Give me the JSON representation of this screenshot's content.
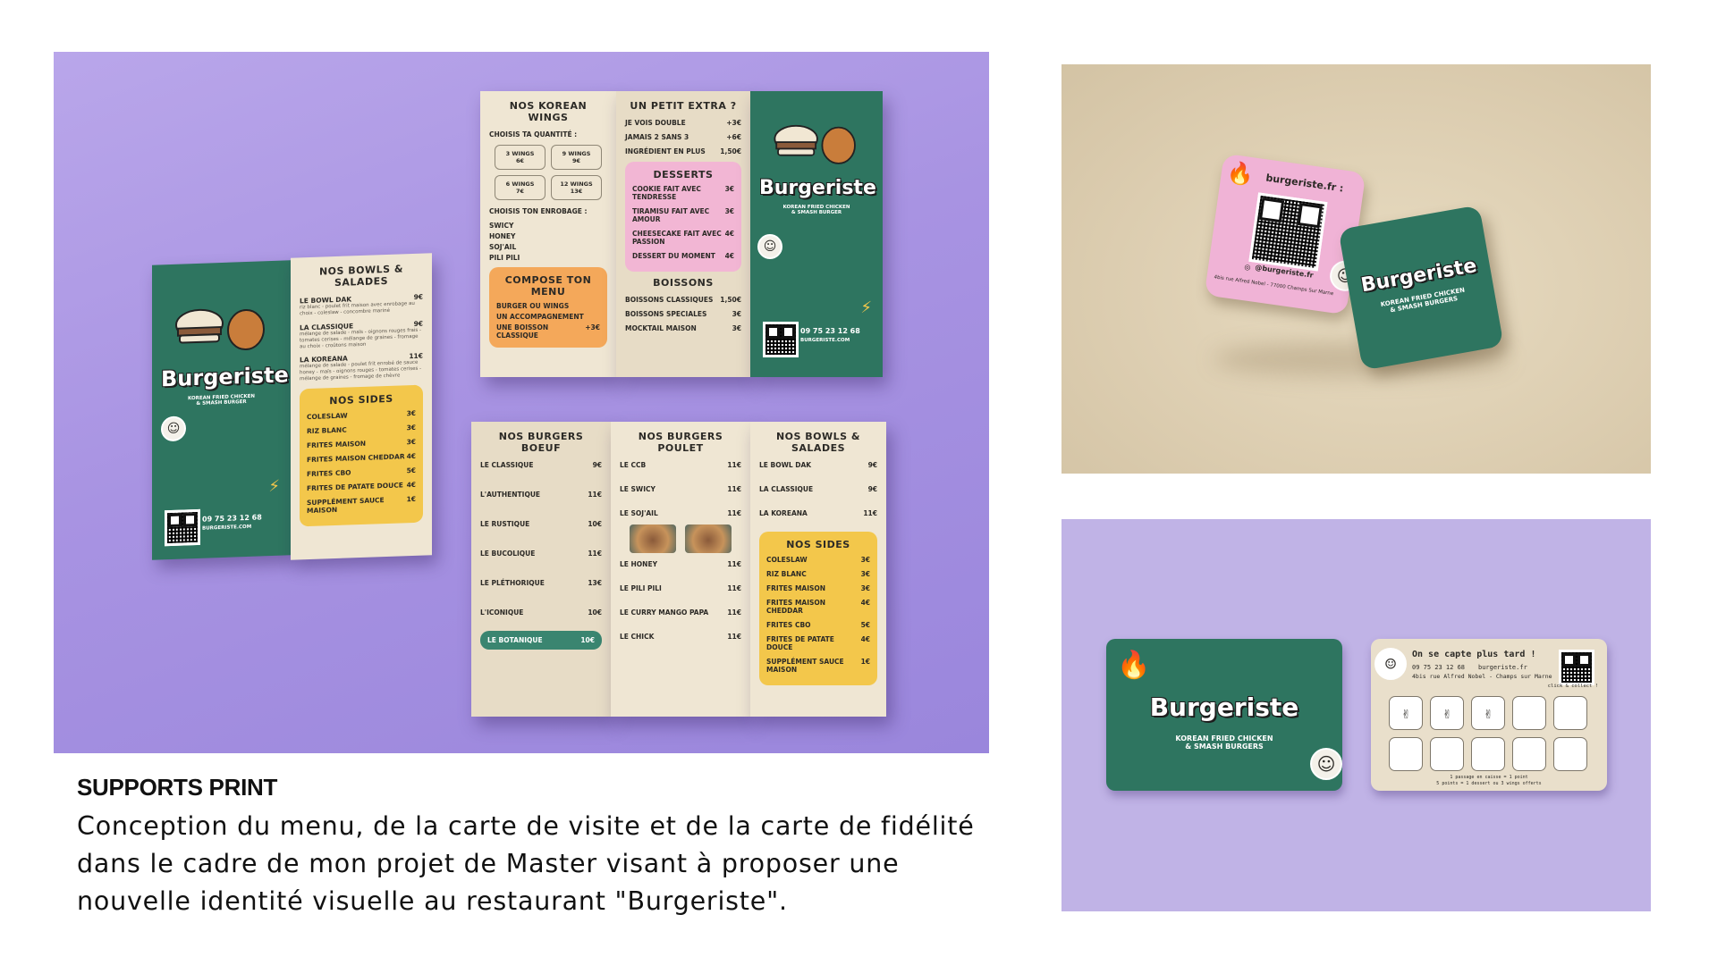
{
  "caption": {
    "title": "SUPPORTS PRINT",
    "text": "Conception du menu, de la carte de visite et de la carte de fidélité dans le cadre de mon projet de Master visant à proposer une nouvelle identité visuelle au restaurant \"Burgeriste\"."
  },
  "brand": {
    "name": "Burgeriste",
    "tagline_1": "KOREAN FRIED CHICKEN",
    "tagline_2": "& SMASH BURGER",
    "tagline_2_plural": "& SMASH BURGERS",
    "phone": "09 75 23 12 68",
    "website": "BURGERISTE.COM",
    "website_lower": "burgeriste.fr",
    "website_label": "burgeriste.fr :",
    "instagram": "@burgeriste.fr",
    "address": "4bis rue Alfred Nobel - 77000 Champs Sur Marne",
    "address_short": "4bis rue Alfred Nobel - Champs sur Marne",
    "colors": {
      "green": "#2e7560",
      "cream": "#efe6d3",
      "yellow": "#f3c74b",
      "pink": "#f2b6d4",
      "purple": "#b9a6ea"
    }
  },
  "menu_left": {
    "bowls_title": "NOS BOWLS & SALADES",
    "bowls": [
      {
        "name": "LE BOWL DAK",
        "price": "9€",
        "desc": "riz blanc - poulet frit maison avec enrobage au choix - coleslaw - concombre mariné"
      },
      {
        "name": "LA CLASSIQUE",
        "price": "9€",
        "desc": "mélange de salade - maïs - oignons rouges frais - tomates cerises - mélange de graines - fromage au choix - croûtons maison"
      },
      {
        "name": "LA KOREANA",
        "price": "11€",
        "desc": "mélange de salade - poulet frit enrobé de sauce honey - maïs - oignons rouges - tomates cerises - mélange de graines - fromage de chèvre"
      }
    ],
    "sides_title": "NOS SIDES",
    "sides": [
      {
        "name": "COLESLAW",
        "price": "3€"
      },
      {
        "name": "RIZ BLANC",
        "price": "3€"
      },
      {
        "name": "FRITES MAISON",
        "price": "3€"
      },
      {
        "name": "FRITES MAISON CHEDDAR",
        "price": "4€"
      },
      {
        "name": "FRITES CBO",
        "price": "5€"
      },
      {
        "name": "FRITES DE PATATE DOUCE",
        "price": "4€"
      },
      {
        "name": "SUPPLÉMENT SAUCE MAISON",
        "price": "1€"
      }
    ]
  },
  "menu_top": {
    "wings_title": "NOS KOREAN WINGS",
    "wings_choose": "CHOISIS TA QUANTITÉ :",
    "wings": [
      {
        "qty": "3 WINGS",
        "price": "6€"
      },
      {
        "qty": "9 WINGS",
        "price": "9€"
      },
      {
        "qty": "6 WINGS",
        "price": "7€"
      },
      {
        "qty": "12 WINGS",
        "price": "13€"
      }
    ],
    "coating_title": "CHOISIS TON ENROBAGE :",
    "coatings": [
      "SWICY",
      "HONEY",
      "SOJ'AIL",
      "PILI PILI"
    ],
    "compose_title": "COMPOSE TON MENU",
    "compose_items": [
      "BURGER OU WINGS",
      "UN ACCOMPAGNEMENT",
      "UNE BOISSON CLASSIQUE"
    ],
    "compose_price": "+3€",
    "extra_title": "UN PETIT EXTRA ?",
    "extras": [
      {
        "name": "JE VOIS DOUBLE",
        "price": "+3€"
      },
      {
        "name": "JAMAIS 2 SANS 3",
        "price": "+6€"
      },
      {
        "name": "INGRÉDIENT EN PLUS",
        "price": "1,50€"
      }
    ],
    "desserts_title": "DESSERTS",
    "desserts": [
      {
        "name": "COOKIE FAIT AVEC TENDRESSE",
        "price": "3€"
      },
      {
        "name": "TIRAMISU FAIT AVEC AMOUR",
        "price": "3€"
      },
      {
        "name": "CHEESECAKE FAIT AVEC PASSION",
        "price": "4€"
      },
      {
        "name": "DESSERT DU MOMENT",
        "price": "4€"
      }
    ],
    "drinks_title": "BOISSONS",
    "drinks": [
      {
        "name": "BOISSONS CLASSIQUES",
        "price": "1,50€"
      },
      {
        "name": "BOISSONS SPECIALES",
        "price": "3€"
      },
      {
        "name": "MOCKTAIL MAISON",
        "price": "3€"
      }
    ]
  },
  "menu_bottom": {
    "beef_title": "NOS BURGERS BOEUF",
    "beef": [
      {
        "name": "LE CLASSIQUE",
        "price": "9€"
      },
      {
        "name": "L'AUTHENTIQUE",
        "price": "11€"
      },
      {
        "name": "LE RUSTIQUE",
        "price": "10€"
      },
      {
        "name": "LE BUCOLIQUE",
        "price": "11€"
      },
      {
        "name": "LE PLÉTHORIQUE",
        "price": "13€"
      },
      {
        "name": "L'ICONIQUE",
        "price": "10€"
      }
    ],
    "beef_special": {
      "name": "LE BOTANIQUE",
      "price": "10€"
    },
    "chicken_title": "NOS BURGERS POULET",
    "chicken": [
      {
        "name": "LE CCB",
        "price": "11€"
      },
      {
        "name": "LE SWICY",
        "price": "11€"
      },
      {
        "name": "LE SOJ'AIL",
        "price": "11€"
      },
      {
        "name": "LE HONEY",
        "price": "11€"
      },
      {
        "name": "LE PILI PILI",
        "price": "11€"
      },
      {
        "name": "LE CURRY MANGO PAPA",
        "price": "11€"
      },
      {
        "name": "LE CHICK",
        "price": "11€"
      }
    ],
    "bowls_title": "NOS BOWLS & SALADES",
    "bowls": [
      {
        "name": "LE BOWL DAK",
        "price": "9€"
      },
      {
        "name": "LA CLASSIQUE",
        "price": "9€"
      },
      {
        "name": "LA KOREANA",
        "price": "11€"
      }
    ],
    "sides_title": "NOS SIDES",
    "sides": [
      {
        "name": "COLESLAW",
        "price": "3€"
      },
      {
        "name": "RIZ BLANC",
        "price": "3€"
      },
      {
        "name": "FRITES MAISON",
        "price": "3€"
      },
      {
        "name": "FRITES MAISON CHEDDAR",
        "price": "4€"
      },
      {
        "name": "FRITES CBO",
        "price": "5€"
      },
      {
        "name": "FRITES DE PATATE DOUCE",
        "price": "4€"
      },
      {
        "name": "SUPPLÉMENT SAUCE MAISON",
        "price": "1€"
      }
    ]
  },
  "loyalty": {
    "heading": "On se capte plus tard !",
    "click_collect": "click & collect !",
    "footnote_1": "1 passage en caisse = 1 point",
    "footnote_2": "5 points = 1 dessert ou 3 wings offerts",
    "stamped": 3,
    "total": 10
  }
}
